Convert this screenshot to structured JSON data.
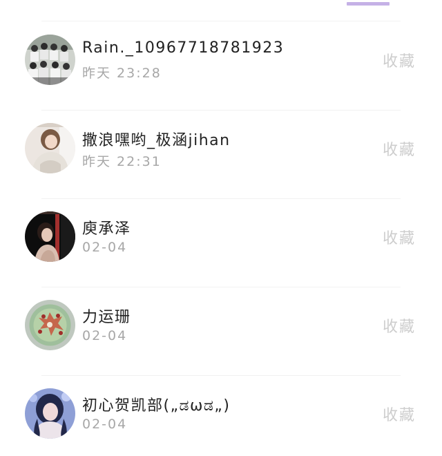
{
  "users": [
    {
      "name": "Rain._10967718781923",
      "time": "昨天 23:28",
      "action_label": "收藏",
      "avatar_icon": "group-photo-avatar"
    },
    {
      "name": "撒浪嘿哟_极涵jihan",
      "time": "昨天 22:31",
      "action_label": "收藏",
      "avatar_icon": "girl-photo-avatar"
    },
    {
      "name": "庾承泽",
      "time": "02-04",
      "action_label": "收藏",
      "avatar_icon": "dark-portrait-avatar"
    },
    {
      "name": "力运珊",
      "time": "02-04",
      "action_label": "收藏",
      "avatar_icon": "cake-photo-avatar"
    },
    {
      "name": "初心贺凯部(„ಡωಡ„)",
      "time": "02-04",
      "action_label": "收藏",
      "avatar_icon": "blue-hair-girl-avatar"
    }
  ],
  "colors": {
    "accent": "#c5b1e6",
    "name_text": "#222222",
    "time_text": "#a7a7a7",
    "action_text": "#cdcdcd"
  }
}
